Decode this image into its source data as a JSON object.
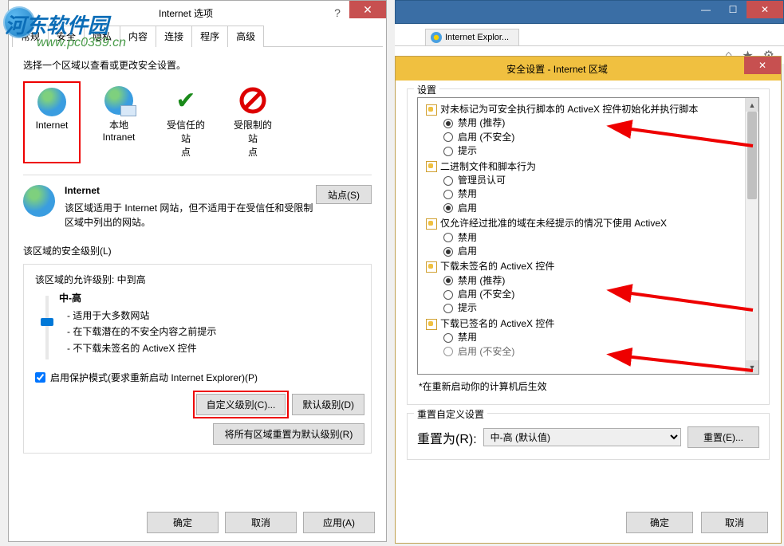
{
  "watermark": {
    "text1": "河东软件园",
    "url": "www.pc0359.cn"
  },
  "left": {
    "title": "Internet 选项",
    "tabs": [
      "常规",
      "安全",
      "隐私",
      "内容",
      "连接",
      "程序",
      "高级"
    ],
    "active_tab": 1,
    "instruction": "选择一个区域以查看或更改安全设置。",
    "zones": [
      {
        "label": "Internet"
      },
      {
        "label": "本地\nIntranet"
      },
      {
        "label": "受信任的站\n点"
      },
      {
        "label": "受限制的站\n点"
      }
    ],
    "zone_detail": {
      "name": "Internet",
      "desc": "该区域适用于 Internet 网站，但不适用于在受信任和受限制区域中列出的网站。",
      "sites_btn": "站点(S)"
    },
    "sec_level_label": "该区域的安全级别(L)",
    "allow_label": "该区域的允许级别: 中到高",
    "level_name": "中-高",
    "bullets": [
      "- 适用于大多数网站",
      "- 在下载潜在的不安全内容之前提示",
      "- 不下载未签名的 ActiveX 控件"
    ],
    "protect_label": "启用保护模式(要求重新启动 Internet Explorer)(P)",
    "custom_btn": "自定义级别(C)...",
    "default_btn": "默认级别(D)",
    "reset_all_btn": "将所有区域重置为默认级别(R)",
    "ok": "确定",
    "cancel": "取消",
    "apply": "应用(A)"
  },
  "browser": {
    "tab_label": "Internet Explor..."
  },
  "right": {
    "title": "安全设置 - Internet 区域",
    "group_label": "设置",
    "tree": [
      {
        "header": "对未标记为可安全执行脚本的 ActiveX 控件初始化并执行脚本",
        "options": [
          {
            "label": "禁用 (推荐)",
            "sel": true
          },
          {
            "label": "启用 (不安全)",
            "sel": false,
            "arrow": true
          },
          {
            "label": "提示",
            "sel": false
          }
        ]
      },
      {
        "header": "二进制文件和脚本行为",
        "options": [
          {
            "label": "管理员认可",
            "sel": false
          },
          {
            "label": "禁用",
            "sel": false
          },
          {
            "label": "启用",
            "sel": true
          }
        ]
      },
      {
        "header": "仅允许经过批准的域在未经提示的情况下使用 ActiveX",
        "options": [
          {
            "label": "禁用",
            "sel": false
          },
          {
            "label": "启用",
            "sel": true
          }
        ]
      },
      {
        "header": "下载未签名的 ActiveX 控件",
        "options": [
          {
            "label": "禁用 (推荐)",
            "sel": true
          },
          {
            "label": "启用 (不安全)",
            "sel": false,
            "arrow": true
          },
          {
            "label": "提示",
            "sel": false
          }
        ]
      },
      {
        "header": "下载已签名的 ActiveX 控件",
        "options": [
          {
            "label": "禁用",
            "sel": false
          },
          {
            "label": "启用 (不安全)",
            "sel": false,
            "arrow": true,
            "cut": true
          }
        ]
      }
    ],
    "note": "*在重新启动你的计算机后生效",
    "reset_group_label": "重置自定义设置",
    "reset_to_label": "重置为(R):",
    "reset_to_value": "中-高 (默认值)",
    "reset_btn": "重置(E)...",
    "ok": "确定",
    "cancel": "取消"
  }
}
